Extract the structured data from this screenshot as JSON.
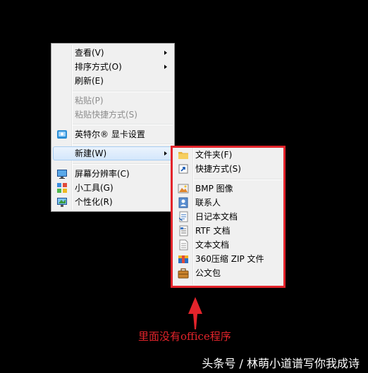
{
  "context_menu": {
    "view": "查看(V)",
    "sort": "排序方式(O)",
    "refresh": "刷新(E)",
    "paste": "粘贴(P)",
    "paste_shortcut": "粘贴快捷方式(S)",
    "intel_graphics": "英特尔® 显卡设置",
    "new": "新建(W)",
    "screen_resolution": "屏幕分辨率(C)",
    "gadgets": "小工具(G)",
    "personalize": "个性化(R)"
  },
  "new_submenu": {
    "folder": "文件夹(F)",
    "shortcut": "快捷方式(S)",
    "bmp_image": "BMP 图像",
    "contact": "联系人",
    "journal_document": "日记本文档",
    "rtf_document": "RTF 文档",
    "text_document": "文本文档",
    "zip_360": "360压缩 ZIP 文件",
    "briefcase": "公文包"
  },
  "annotation": "里面没有office程序",
  "watermark": "头条号 / 林萌小道谱写你我成诗",
  "colors": {
    "background": "#000000",
    "menu_bg": "#f0f0f0",
    "highlight": "#d4e7fb",
    "annotation_red": "#e3242b"
  }
}
